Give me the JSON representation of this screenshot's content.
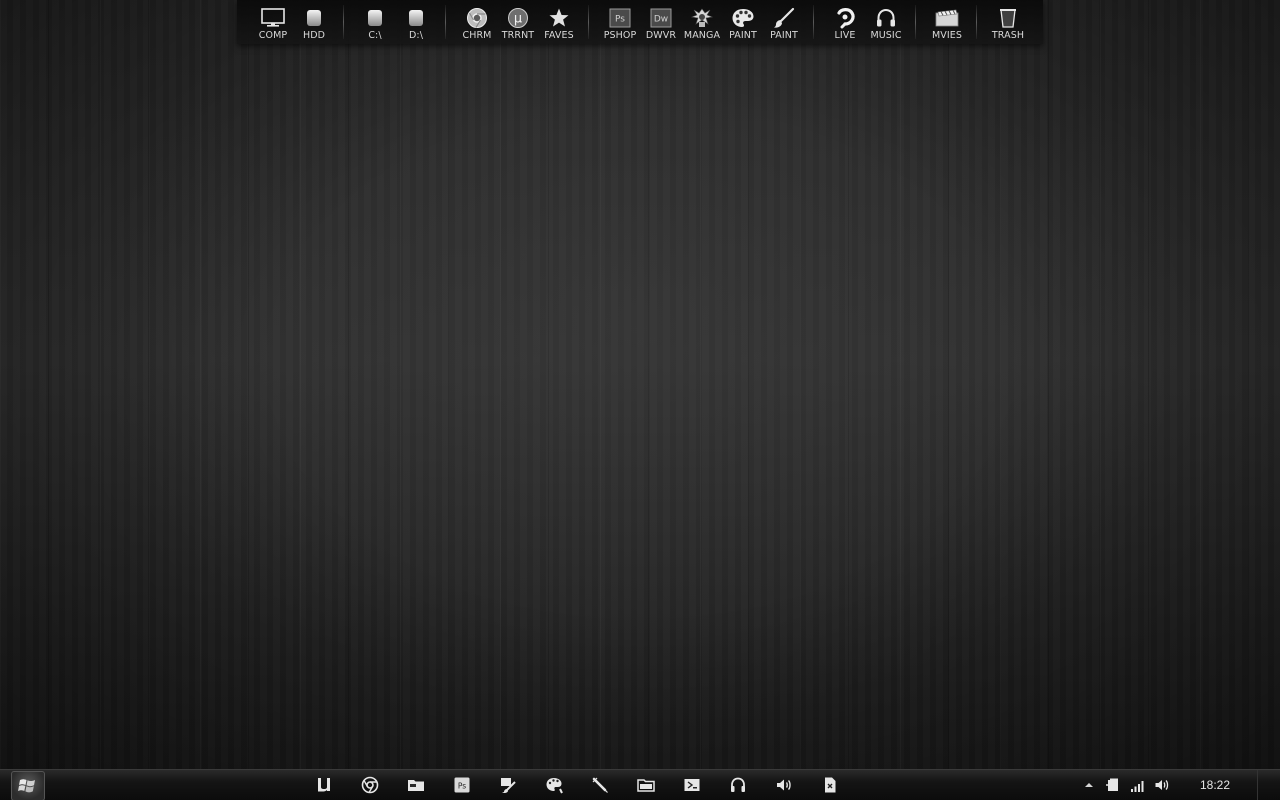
{
  "dock": {
    "items": [
      {
        "label": "COMP",
        "icon": "monitor-icon"
      },
      {
        "label": "HDD",
        "icon": "hard-drive-icon"
      },
      {
        "label": "C:\\",
        "icon": "drive-c-icon"
      },
      {
        "label": "D:\\",
        "icon": "drive-d-icon"
      },
      {
        "label": "CHRM",
        "icon": "chrome-icon"
      },
      {
        "label": "TRRNT",
        "icon": "utorrent-icon"
      },
      {
        "label": "FAVES",
        "icon": "star-icon"
      },
      {
        "label": "PSHOP",
        "icon": "photoshop-icon",
        "glyph": "Ps"
      },
      {
        "label": "DWVR",
        "icon": "dreamweaver-icon",
        "glyph": "Dw"
      },
      {
        "label": "MANGA",
        "icon": "manga-samurai-icon"
      },
      {
        "label": "PAINT",
        "icon": "palette-icon"
      },
      {
        "label": "PAINT",
        "icon": "brush-icon"
      },
      {
        "label": "LIVE",
        "icon": "windows-live-icon"
      },
      {
        "label": "MUSIC",
        "icon": "headphones-icon"
      },
      {
        "label": "MVIES",
        "icon": "movies-folder-icon"
      },
      {
        "label": "TRASH",
        "icon": "trash-icon"
      }
    ]
  },
  "taskbar": {
    "apps": [
      {
        "name": "utorrent-task-icon"
      },
      {
        "name": "chrome-task-icon"
      },
      {
        "name": "folder-task-icon"
      },
      {
        "name": "photoshop-task-icon",
        "glyph": "Ps"
      },
      {
        "name": "brush-task-icon"
      },
      {
        "name": "palette-task-icon"
      },
      {
        "name": "pen-task-icon"
      },
      {
        "name": "explorer-task-icon"
      },
      {
        "name": "control-panel-task-icon"
      },
      {
        "name": "headphones-task-icon"
      },
      {
        "name": "speaker-task-icon"
      },
      {
        "name": "document-task-icon"
      }
    ],
    "tray": {
      "clock": "18:22"
    }
  },
  "colors": {
    "background": "#1e1e1e",
    "text": "#d8d8d8",
    "icon": "#e0e0e0"
  }
}
